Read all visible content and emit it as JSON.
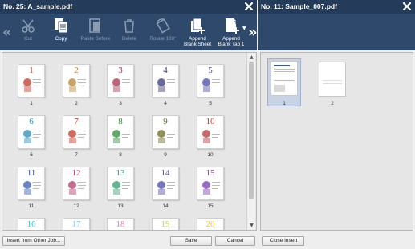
{
  "left_panel": {
    "title": "No. 25: A_sample.pdf",
    "toolbar": [
      {
        "label": "Cut",
        "icon": "scissors-icon",
        "enabled": false
      },
      {
        "label": "Copy",
        "icon": "copy-icon",
        "enabled": true
      },
      {
        "label": "Paste Before",
        "icon": "paste-icon",
        "enabled": false
      },
      {
        "label": "Delete",
        "icon": "trash-icon",
        "enabled": false
      },
      {
        "label": "Rotate 180°",
        "icon": "rotate-icon",
        "enabled": false
      },
      {
        "label": "Append\nBlank Sheet",
        "icon": "blank-sheet-icon",
        "enabled": true
      },
      {
        "label": "Append\nBlank Tab 1",
        "icon": "blank-tab-icon",
        "enabled": true
      }
    ],
    "pages": [
      {
        "num": "1",
        "color": "#c0392b"
      },
      {
        "num": "2",
        "color": "#b8843a"
      },
      {
        "num": "3",
        "color": "#a8324a"
      },
      {
        "num": "4",
        "color": "#3a3a7a"
      },
      {
        "num": "5",
        "color": "#4a4aa8"
      },
      {
        "num": "6",
        "color": "#2e8bb8"
      },
      {
        "num": "7",
        "color": "#c0392b"
      },
      {
        "num": "8",
        "color": "#2e8b3a"
      },
      {
        "num": "9",
        "color": "#6a6a20"
      },
      {
        "num": "10",
        "color": "#b03a3a"
      },
      {
        "num": "11",
        "color": "#3a5ab0"
      },
      {
        "num": "12",
        "color": "#b03a6a"
      },
      {
        "num": "13",
        "color": "#2e9b6a"
      },
      {
        "num": "14",
        "color": "#4a4aa8"
      },
      {
        "num": "15",
        "color": "#7a3ab0"
      },
      {
        "num": "16",
        "color": "#4ab8c8"
      },
      {
        "num": "17",
        "color": "#8ac8e8"
      },
      {
        "num": "18",
        "color": "#e87ab8"
      },
      {
        "num": "19",
        "color": "#c8c85a"
      },
      {
        "num": "20",
        "color": "#e8c84a"
      }
    ],
    "buttons": {
      "insert_other": "Insert from Other Job...",
      "save": "Save",
      "cancel": "Cancel"
    }
  },
  "right_panel": {
    "title": "No. 11: Sample_007.pdf",
    "pages": [
      {
        "num": "1"
      },
      {
        "num": "2"
      }
    ],
    "buttons": {
      "close_insert": "Close Insert"
    }
  },
  "colors": {
    "title_bar": "#243b59",
    "toolbar": "#2e496b",
    "selection": "#c8d3e3"
  }
}
